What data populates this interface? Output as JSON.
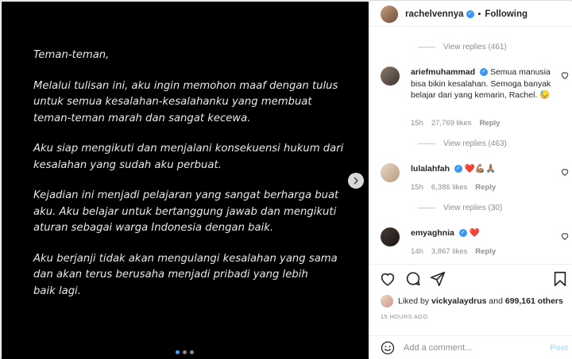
{
  "post": {
    "paragraphs": [
      "Teman-teman,",
      "Melalui tulisan ini,  aku ingin memohon maaf dengan tulus\nuntuk semua kesalahan-kesalahanku yang membuat\nteman-teman marah dan sangat kecewa.",
      "Aku siap mengikuti dan menjalani konsekuensi hukum dari\nkesalahan yang sudah aku perbuat.",
      "Kejadian ini menjadi pelajaran yang sangat berharga buat\naku. Aku belajar untuk bertanggung jawab dan mengikuti\naturan sebagai warga Indonesia dengan baik.",
      "Aku berjanji tidak akan mengulangi kesalahan yang sama\ndan akan terus berusaha menjadi pribadi yang lebih\nbaik lagi."
    ],
    "carousel_pages": 3,
    "carousel_active": 1
  },
  "header": {
    "username": "rachelvennya",
    "separator": "•",
    "follow_status": "Following"
  },
  "view_replies": [
    "View replies (461)",
    "View replies (463)",
    "View replies (30)"
  ],
  "comments": [
    {
      "username": "ariefmuhammad",
      "text": "Semua manusia bisa bikin kesalahan. Semoga banyak belajar dari yang kemarin, Rachel. 😓",
      "age": "15h",
      "likes": "27,769 likes",
      "reply": "Reply"
    },
    {
      "username": "lulalahfah",
      "text": "❤️💪🏽🙏🏽",
      "age": "15h",
      "likes": "6,386 likes",
      "reply": "Reply"
    },
    {
      "username": "emyaghnia",
      "text": "❤️",
      "age": "14h",
      "likes": "3,867 likes",
      "reply": "Reply"
    }
  ],
  "likes": {
    "prefix": "Liked by",
    "user": "vickyalaydrus",
    "connector": "and",
    "others": "699,161 others"
  },
  "timestamp": "15 HOURS AGO",
  "add_comment": {
    "placeholder": "Add a comment...",
    "post_label": "Post"
  },
  "icons": [
    "heart-icon",
    "comment-icon",
    "share-icon",
    "bookmark-icon",
    "emoji-icon",
    "chevron-right-icon",
    "verified-icon"
  ],
  "colors": {
    "verified": "#3897f0",
    "active_dot": "#4aa3f5",
    "muted": "#8e8e8e",
    "post_disabled": "#b2dffc"
  }
}
